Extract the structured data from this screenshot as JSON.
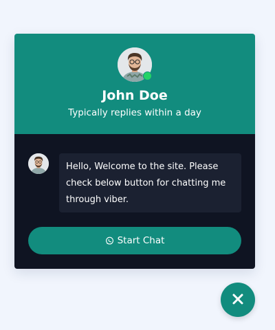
{
  "colors": {
    "accent": "#128c7e",
    "online": "#25d366",
    "body_bg": "#0f1422",
    "bubble_bg": "#1b2131",
    "page_bg": "#f1f5fd"
  },
  "agent": {
    "name": "John Doe",
    "status_text": "Typically replies within a day",
    "online": true,
    "avatar_icon": "person-avatar"
  },
  "message": {
    "text": "Hello, Welcome to the site. Please check below button for chatting me through viber."
  },
  "start_button": {
    "label": "Start Chat",
    "icon": "whatsapp-icon"
  },
  "close_button": {
    "icon": "close-icon"
  }
}
